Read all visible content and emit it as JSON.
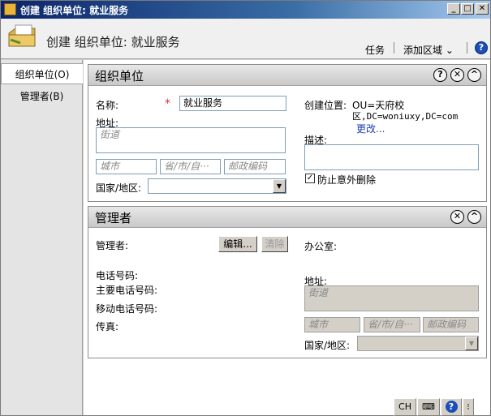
{
  "window": {
    "title": "创建 组织单位: 就业服务"
  },
  "header": {
    "title": "创建 组织单位: 就业服务",
    "task_label": "任务",
    "add_area_label": "添加区域",
    "help_label": "?"
  },
  "sidebar": {
    "items": [
      {
        "label": "组织单位(O)"
      },
      {
        "label": "管理者(B)"
      }
    ]
  },
  "ou_panel": {
    "title": "组织单位",
    "name_label": "名称:",
    "name_value": "就业服务",
    "address_label": "地址:",
    "street_placeholder": "街道",
    "city_placeholder": "城市",
    "province_placeholder": "省/市/自···",
    "zip_placeholder": "邮政编码",
    "country_label": "国家/地区:",
    "create_location_label": "创建位置:",
    "create_location_value_1": "OU=天府校",
    "create_location_value_2": "区,DC=woniuxy,DC=com",
    "change_link": "更改...",
    "description_label": "描述:",
    "protect_label": "防止意外删除",
    "protect_checked": true
  },
  "manager_panel": {
    "title": "管理者",
    "manager_label": "管理者:",
    "edit_button": "编辑...",
    "clear_button": "清除",
    "office_label": "办公室:",
    "phone_label": "电话号码:",
    "main_phone_label": "主要电话号码:",
    "mobile_label": "移动电话号码:",
    "fax_label": "传真:",
    "address_label": "地址:",
    "street_placeholder": "街道",
    "city_placeholder": "城市",
    "province_placeholder": "省/市/自···",
    "zip_placeholder": "邮政编码",
    "country_label": "国家/地区:"
  },
  "statusbar": {
    "ime_label": "CH"
  }
}
